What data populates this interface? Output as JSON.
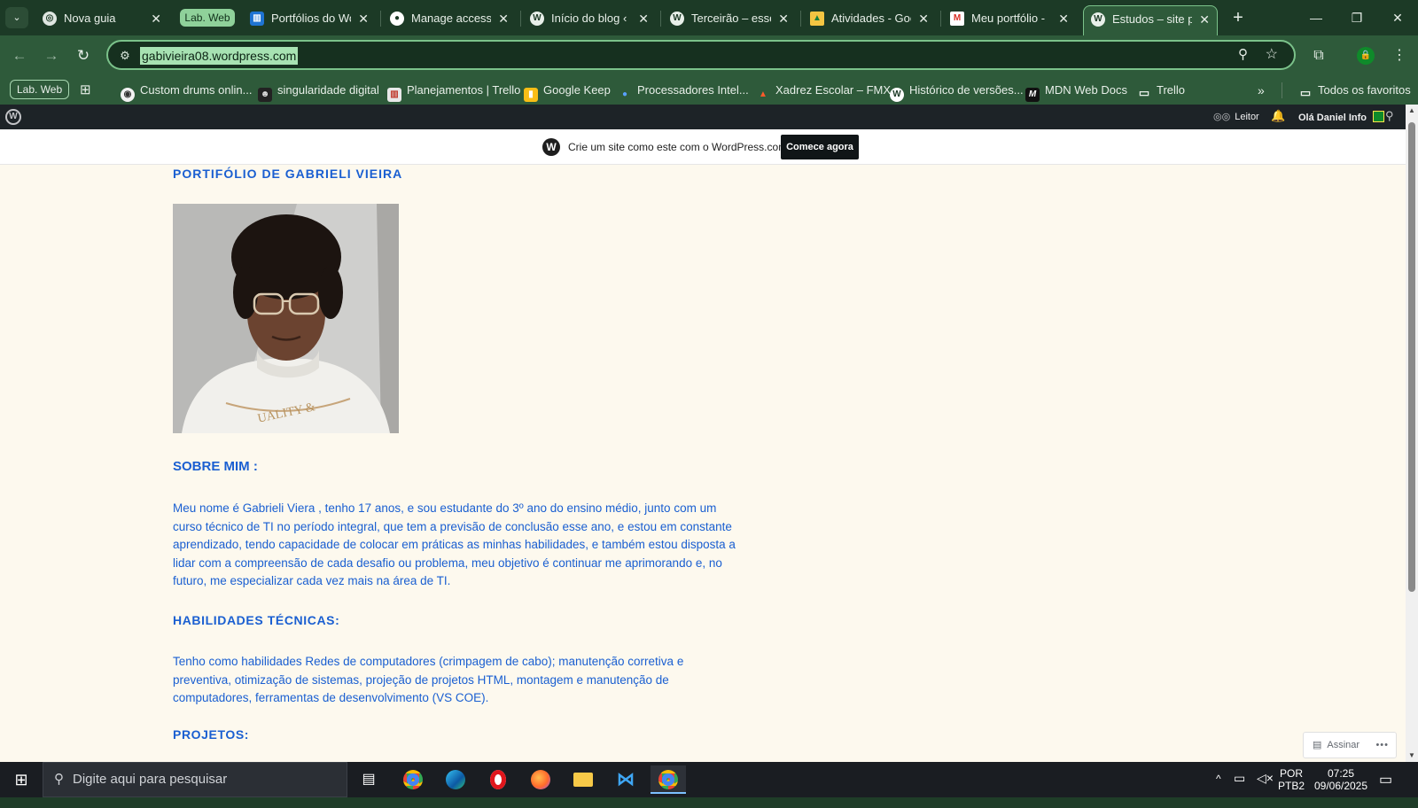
{
  "browser": {
    "tabs": [
      {
        "title": "Nova guia",
        "favicon": "chrome-icon"
      },
      {
        "title": "Portfólios do Wo",
        "favicon": "trello-icon"
      },
      {
        "title": "Manage access",
        "favicon": "github-icon"
      },
      {
        "title": "Início do blog ‹ I",
        "favicon": "wordpress-icon"
      },
      {
        "title": "Terceirão – esse",
        "favicon": "wordpress-icon"
      },
      {
        "title": "Atividades - Goo",
        "favicon": "google-drive-icon"
      },
      {
        "title": "Meu portfólio -",
        "favicon": "gmail-icon"
      },
      {
        "title": "Estudos – site pa",
        "favicon": "wordpress-icon"
      }
    ],
    "tab_group_label": "Lab. Web",
    "url": "gabivieira08.wordpress.com",
    "bookmarks_group_label": "Lab. Web",
    "bookmarks": [
      {
        "label": "Custom drums onlin...",
        "icon": "drum-icon"
      },
      {
        "label": "singularidade digital",
        "icon": "person-icon"
      },
      {
        "label": "Planejamentos | Trello",
        "icon": "trello-icon"
      },
      {
        "label": "Google Keep",
        "icon": "keep-icon"
      },
      {
        "label": "Processadores Intel...",
        "icon": "intel-icon"
      },
      {
        "label": "Xadrez Escolar – FMX",
        "icon": "chess-icon"
      },
      {
        "label": "Histórico de versões...",
        "icon": "wordpress-icon"
      },
      {
        "label": "MDN Web Docs",
        "icon": "mdn-icon"
      },
      {
        "label": "Trello",
        "icon": "folder-icon"
      }
    ],
    "all_bookmarks_label": "Todos os favoritos"
  },
  "wpadmin": {
    "reader_label": "Leitor",
    "greeting": "Olá Daniel Info"
  },
  "banner": {
    "text": "Crie um site como este com o WordPress.com",
    "cta": "Comece agora"
  },
  "page": {
    "site_title": "PORTIFÓLIO DE GABRIELI VIEIRA",
    "about_heading": "SOBRE MIM :",
    "about_text": "Meu nome é Gabrieli Viera , tenho 17 anos, e sou estudante do 3º ano do ensino médio, junto com um curso técnico de TI no período integral, que tem a previsão de conclusão esse ano, e estou em constante aprendizado, tendo capacidade de colocar em práticas as minhas habilidades, e também estou disposta a lidar com a compreensão de cada desafio ou problema, meu objetivo é continuar me aprimorando e, no futuro, me especializar cada vez mais na área de TI.",
    "skills_heading": "HABILIDADES TÉCNICAS:",
    "skills_text": "Tenho como habilidades Redes de computadores (crimpagem de cabo); manutenção corretiva e preventiva, otimização de sistemas, projeção de projetos HTML, montagem e manutenção de computadores, ferramentas de desenvolvimento (VS COE).",
    "projects_heading": "PROJETOS:",
    "follow_label": "Assinar"
  },
  "taskbar": {
    "search_placeholder": "Digite aqui para pesquisar",
    "language": "POR",
    "layout": "PTB2",
    "time": "07:25",
    "date": "09/06/2025"
  },
  "colors": {
    "accent_text": "#1a5fd1",
    "page_bg": "#fdf9ee",
    "browser_frame": "#2e5a3a",
    "url_highlight": "#a7e2b2"
  }
}
